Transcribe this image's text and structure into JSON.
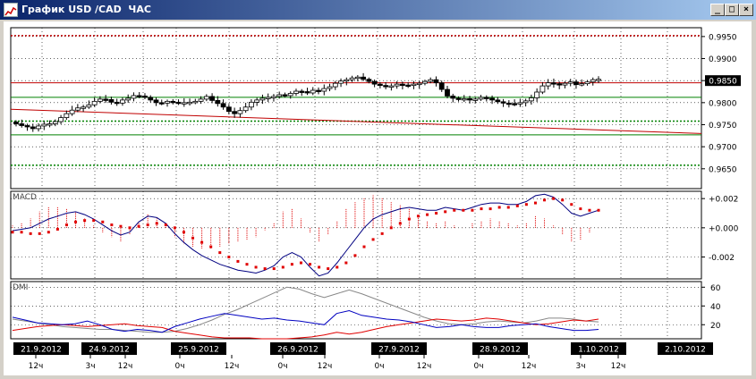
{
  "window": {
    "title": "График USD /CAD  ЧАС",
    "minimize_glyph": "_",
    "maximize_glyph": "□",
    "close_glyph": "×"
  },
  "colors": {
    "candle": "#000000",
    "macd_line": "#000080",
    "macd_signal": "#e00000",
    "dmi_adx": "#888888",
    "dmi_plus": "#0000c0",
    "dmi_minus": "#e00000",
    "price_tag_bg": "#000000",
    "level_red": "#c00000",
    "level_green": "#008000"
  },
  "chart_data": [
    {
      "type": "candlestick",
      "instrument": "USD /CAD",
      "timeframe": "ЧАС",
      "ylim": [
        0.9605,
        0.997
      ],
      "y_ticks": [
        "0.9950",
        "0.9900",
        "0.9850",
        "0.9800",
        "0.9750",
        "0.9700",
        "0.9650"
      ],
      "current_price": "0.9850",
      "close": [
        0.9752,
        0.9748,
        0.9745,
        0.9741,
        0.9747,
        0.9751,
        0.9752,
        0.9757,
        0.9766,
        0.9775,
        0.9783,
        0.9788,
        0.979,
        0.9795,
        0.9803,
        0.9808,
        0.9807,
        0.9801,
        0.9799,
        0.9806,
        0.981,
        0.9816,
        0.9815,
        0.9812,
        0.9806,
        0.98,
        0.9799,
        0.9803,
        0.9801,
        0.9799,
        0.98,
        0.9801,
        0.9803,
        0.9808,
        0.9814,
        0.9805,
        0.9798,
        0.979,
        0.978,
        0.9775,
        0.9782,
        0.979,
        0.9801,
        0.9806,
        0.981,
        0.9812,
        0.9814,
        0.9818,
        0.9816,
        0.9821,
        0.9826,
        0.9825,
        0.9822,
        0.9828,
        0.9826,
        0.9832,
        0.9836,
        0.9844,
        0.9849,
        0.9852,
        0.9856,
        0.9858,
        0.9853,
        0.9848,
        0.9842,
        0.9839,
        0.9837,
        0.9838,
        0.9842,
        0.984,
        0.9839,
        0.9842,
        0.9844,
        0.9848,
        0.9852,
        0.9845,
        0.983,
        0.9815,
        0.981,
        0.9808,
        0.9809,
        0.9807,
        0.9808,
        0.9812,
        0.981,
        0.9806,
        0.9802,
        0.9799,
        0.9798,
        0.9797,
        0.98,
        0.9804,
        0.9811,
        0.9824,
        0.9838,
        0.9845,
        0.9843,
        0.984,
        0.9844,
        0.9847,
        0.9841,
        0.9843,
        0.9847,
        0.9852,
        0.9853
      ],
      "levels": [
        {
          "value": 0.9952,
          "style": "dotted",
          "color": "level_red"
        },
        {
          "value": 0.9845,
          "style": "solid",
          "color": "level_red"
        },
        {
          "value": 0.9812,
          "style": "solid",
          "color": "level_green"
        },
        {
          "value": 0.9758,
          "style": "dotted",
          "color": "level_green"
        },
        {
          "value": 0.9727,
          "style": "solid",
          "color": "level_green"
        },
        {
          "value": 0.9658,
          "style": "dotted",
          "color": "level_green"
        }
      ],
      "trendline": {
        "from": 0.9785,
        "to": 0.973,
        "color": "level_red"
      }
    },
    {
      "type": "line",
      "label": "MACD",
      "ylim": [
        -0.0035,
        0.0025
      ],
      "y_ticks": [
        "+0.002",
        "+0.000",
        "-0.002"
      ],
      "macd": [
        -0.0002,
        -0.0001,
        0.0,
        0.0003,
        0.0006,
        0.0008,
        0.001,
        0.0011,
        0.0009,
        0.0006,
        0.0002,
        -0.0002,
        -0.0005,
        -0.0003,
        0.0004,
        0.0008,
        0.0007,
        0.0003,
        -0.0004,
        -0.001,
        -0.0015,
        -0.0019,
        -0.0022,
        -0.0025,
        -0.0027,
        -0.0029,
        -0.003,
        -0.0031,
        -0.0029,
        -0.0026,
        -0.002,
        -0.0017,
        -0.002,
        -0.0027,
        -0.0033,
        -0.0031,
        -0.0024,
        -0.0016,
        -0.0008,
        0.0,
        0.0006,
        0.0009,
        0.0011,
        0.0013,
        0.0014,
        0.0013,
        0.0012,
        0.0012,
        0.0014,
        0.0013,
        0.0012,
        0.0014,
        0.0016,
        0.0017,
        0.0017,
        0.0016,
        0.0016,
        0.0018,
        0.0022,
        0.0023,
        0.0021,
        0.0016,
        0.001,
        0.0008,
        0.001,
        0.0012
      ],
      "signal": [
        -0.0003,
        -0.0003,
        -0.0004,
        -0.0004,
        -0.0003,
        -0.0001,
        0.0002,
        0.0004,
        0.0005,
        0.0005,
        0.0004,
        0.0002,
        0.0001,
        0.0,
        0.0001,
        0.0002,
        0.0003,
        0.0002,
        0.0,
        -0.0003,
        -0.0007,
        -0.001,
        -0.0013,
        -0.0017,
        -0.002,
        -0.0023,
        -0.0025,
        -0.0027,
        -0.0028,
        -0.0028,
        -0.0027,
        -0.0025,
        -0.0024,
        -0.0025,
        -0.0027,
        -0.0028,
        -0.0027,
        -0.0024,
        -0.0019,
        -0.0013,
        -0.0008,
        -0.0004,
        0.0,
        0.0003,
        0.0006,
        0.0008,
        0.0009,
        0.001,
        0.0011,
        0.0012,
        0.0012,
        0.0012,
        0.0013,
        0.0013,
        0.0014,
        0.0014,
        0.0015,
        0.0016,
        0.0017,
        0.0019,
        0.002,
        0.0019,
        0.0016,
        0.0013,
        0.0012,
        0.0012
      ]
    },
    {
      "type": "line",
      "label": "DMI",
      "ylim": [
        5,
        66
      ],
      "y_ticks": [
        "60",
        "40",
        "20"
      ],
      "adx": [
        26,
        24,
        22,
        20,
        18,
        17,
        16,
        15,
        15,
        14,
        13,
        12,
        12,
        13,
        16,
        20,
        25,
        31,
        36,
        42,
        48,
        54,
        60,
        58,
        53,
        49,
        53,
        57,
        53,
        48,
        43,
        38,
        33,
        28,
        24,
        21,
        20,
        21,
        23,
        24,
        23,
        22,
        24,
        27,
        27,
        26,
        24,
        23
      ],
      "plus_di": [
        28,
        25,
        22,
        21,
        20,
        21,
        24,
        20,
        15,
        13,
        15,
        14,
        12,
        18,
        22,
        26,
        29,
        32,
        30,
        28,
        26,
        27,
        25,
        24,
        22,
        20,
        32,
        35,
        30,
        28,
        26,
        25,
        23,
        20,
        17,
        18,
        20,
        18,
        17,
        17,
        19,
        20,
        21,
        18,
        16,
        14,
        14,
        15
      ],
      "minus_di": [
        14,
        16,
        18,
        19,
        20,
        19,
        18,
        19,
        20,
        21,
        19,
        18,
        17,
        13,
        11,
        9,
        7,
        6,
        6,
        6,
        5,
        5,
        5,
        6,
        7,
        9,
        12,
        10,
        12,
        15,
        18,
        20,
        22,
        24,
        26,
        25,
        24,
        25,
        27,
        26,
        24,
        22,
        20,
        21,
        23,
        25,
        24,
        26
      ]
    }
  ],
  "time_axis": {
    "dates": [
      {
        "label": "21.9.2012",
        "style": "dark"
      },
      {
        "label": "24.9.2012",
        "style": "dark"
      },
      {
        "label": "25.9.2012",
        "style": "dark"
      },
      {
        "label": "26.9.2012",
        "style": "dark"
      },
      {
        "label": "27.9.2012",
        "style": "dark"
      },
      {
        "label": "28.9.2012",
        "style": "dark"
      },
      {
        "label": "1.10.2012",
        "style": "dark"
      },
      {
        "label": "2.10.2012",
        "style": "dark"
      }
    ],
    "hours": [
      "12ч",
      "3ч",
      "12ч",
      "0ч",
      "12ч",
      "0ч",
      "12ч",
      "0ч",
      "12ч",
      "0ч",
      "12ч",
      "3ч",
      "12ч"
    ]
  }
}
